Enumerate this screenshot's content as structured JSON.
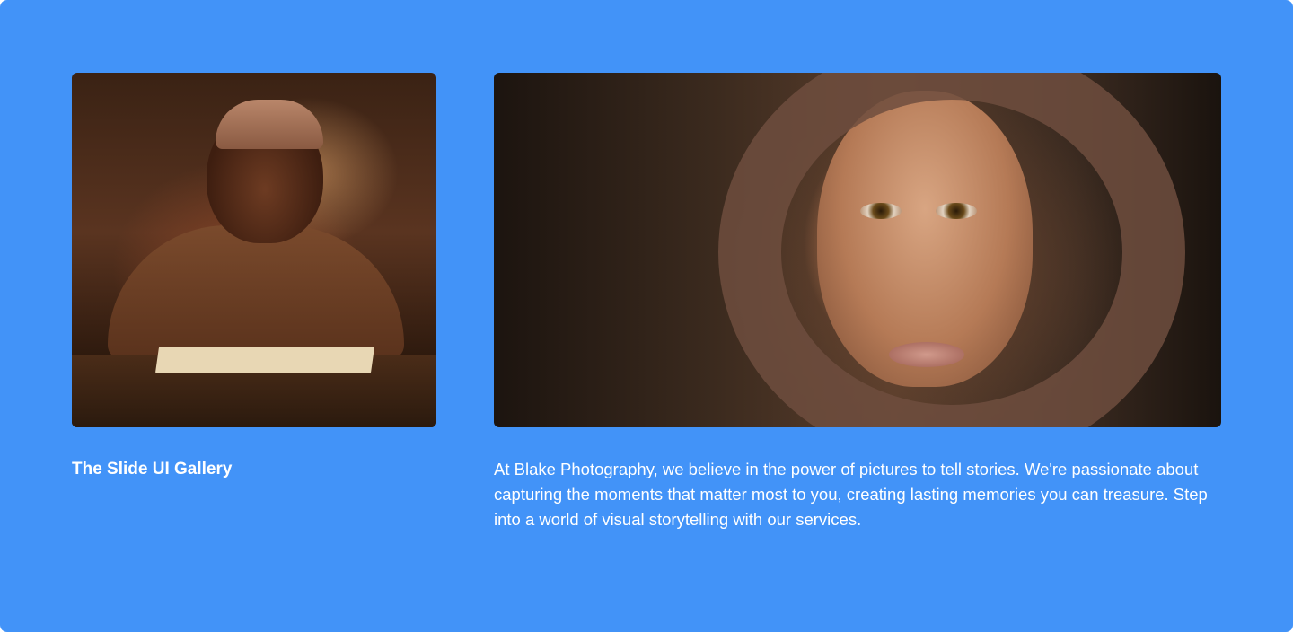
{
  "gallery": {
    "title": "The Slide UI Gallery",
    "description": "At Blake Photography, we believe in the power of pictures to tell stories. We're passionate about capturing the moments that matter most to you, creating lasting memories you can treasure. Step into a world of visual storytelling with our services."
  },
  "colors": {
    "background": "#4293f8",
    "text": "#ffffff"
  }
}
